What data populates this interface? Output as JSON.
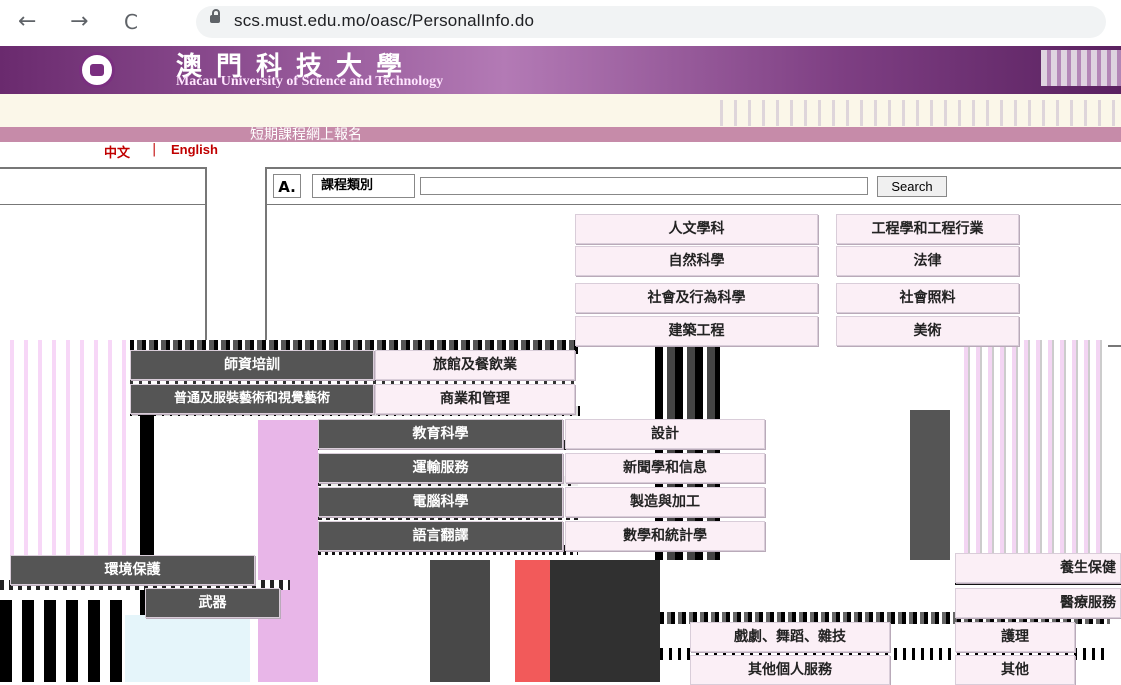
{
  "browser": {
    "back_icon": "←",
    "forward_icon": "→",
    "reload_icon": "C",
    "url": "scs.must.edu.mo/oasc/PersonalInfo.do"
  },
  "banner": {
    "name_zh": "澳門科技大學",
    "name_en": "Macau University of Science and Technology"
  },
  "page_title": "短期課程網上報名",
  "language": {
    "zh": "中文",
    "separator": "|",
    "en": "English"
  },
  "search": {
    "section_letter": "A.",
    "label": "課程類別",
    "value": "",
    "button": "Search"
  },
  "categories": [
    "人文學科",
    "工程學和工程行業",
    "自然科學",
    "法律",
    "社會及行為科學",
    "社會照料",
    "建築工程",
    "美術",
    "師資培訓",
    "旅館及餐飲業",
    "普通及服裝藝術和視覺藝術",
    "商業和管理",
    "教育科學",
    "設計",
    "運輸服務",
    "新聞學和信息",
    "電腦科學",
    "製造與加工",
    "語言翻譯",
    "數學和統計學",
    "環境保護",
    "養生保健",
    "武器",
    "醫療服務",
    "戲劇、舞蹈、雜技",
    "護理",
    "其他個人服務",
    "其他"
  ],
  "colors": {
    "title_bar": "#c68ba9",
    "lang_link": "#c00000",
    "button_bg": "#fbeff6",
    "banner": "#7e3f83"
  }
}
